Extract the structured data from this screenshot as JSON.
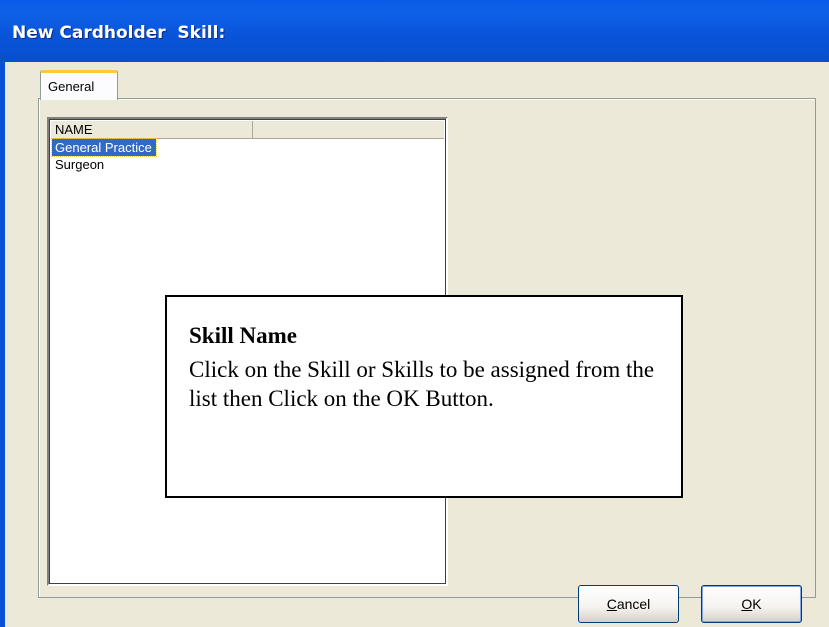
{
  "window": {
    "title": "New Cardholder  Skill:"
  },
  "tabs": [
    {
      "label": "General",
      "active": true
    }
  ],
  "list": {
    "columns": [
      "NAME",
      ""
    ],
    "rows": [
      {
        "name": "General Practice",
        "selected": true
      },
      {
        "name": "Surgeon",
        "selected": false
      }
    ]
  },
  "callout": {
    "title": "Skill Name",
    "body": "Click on the Skill or Skills to be assigned from the list then Click on the OK Button."
  },
  "buttons": {
    "cancel_mnemonic": "C",
    "cancel_rest": "ancel",
    "ok_mnemonic": "O",
    "ok_rest": "K"
  },
  "colors": {
    "titlebar": "#0A59E8",
    "selection": "#316AC5",
    "face": "#ECE9D8"
  }
}
